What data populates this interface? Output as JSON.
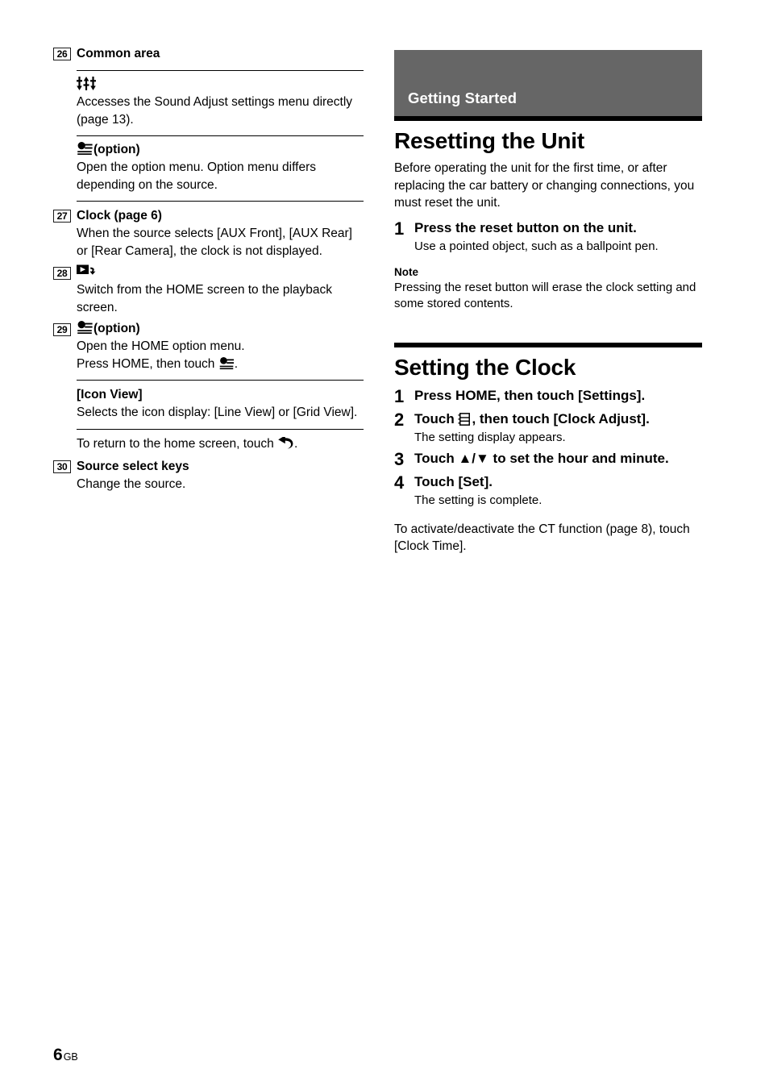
{
  "page": {
    "number": "6",
    "suffix": "GB"
  },
  "left_column": {
    "items": [
      {
        "num": "26",
        "head": "Common area",
        "sub_entries": [
          {
            "icon": "sound-adjust-slider-icon",
            "label": "",
            "text": "Accesses the Sound Adjust settings menu directly (page 13)."
          },
          {
            "icon": "option-menu-icon",
            "label": "(option)",
            "text": "Open the option menu. Option menu differs depending on the source."
          }
        ]
      },
      {
        "num": "27",
        "head": "Clock (page 6)",
        "text": "When the source selects [AUX Front], [AUX Rear] or [Rear Camera], the clock is not displayed."
      },
      {
        "num": "28",
        "head": "",
        "icon": "playback-screen-return-icon",
        "text": "Switch from the HOME screen to the playback screen."
      },
      {
        "num": "29",
        "head": "(option)",
        "icon": "option-menu-icon",
        "text_line1": "Open the HOME option menu.",
        "text_line2_pre": "Press HOME, then touch ",
        "text_line2_post": ".",
        "sub_entry": {
          "label": "[Icon View]",
          "text": "Selects the icon display: [Line View] or [Grid View]."
        },
        "return_note_pre": "To return to the home screen, touch ",
        "return_note_post": "."
      },
      {
        "num": "30",
        "head": "Source select keys",
        "text": "Change the source."
      }
    ]
  },
  "right_column": {
    "banner": "Getting Started",
    "section1": {
      "title": "Resetting the Unit",
      "intro": "Before operating the unit for the first time, or after replacing the car battery or changing connections, you must reset the unit.",
      "steps": [
        {
          "num": "1",
          "title": "Press the reset button on the unit.",
          "sub": "Use a pointed object, such as a ballpoint pen."
        }
      ],
      "note_label": "Note",
      "note_text": "Pressing the reset button will erase the clock setting and some stored contents."
    },
    "section2": {
      "title": "Setting the Clock",
      "steps": [
        {
          "num": "1",
          "title": "Press HOME, then touch [Settings].",
          "sub": ""
        },
        {
          "num": "2",
          "title_pre": "Touch ",
          "title_post": ", then touch [Clock Adjust].",
          "icon": "settings-list-icon",
          "sub": "The setting display appears."
        },
        {
          "num": "3",
          "title": "Touch ▲/▼ to set the hour and minute.",
          "sub": ""
        },
        {
          "num": "4",
          "title": "Touch [Set].",
          "sub": "The setting is complete."
        }
      ],
      "tail": "To activate/deactivate the CT function (page 8), touch [Clock Time]."
    }
  },
  "colors": {
    "banner_bg": "#666666",
    "banner_text": "#ffffff",
    "rule": "#000000",
    "text": "#000000"
  }
}
